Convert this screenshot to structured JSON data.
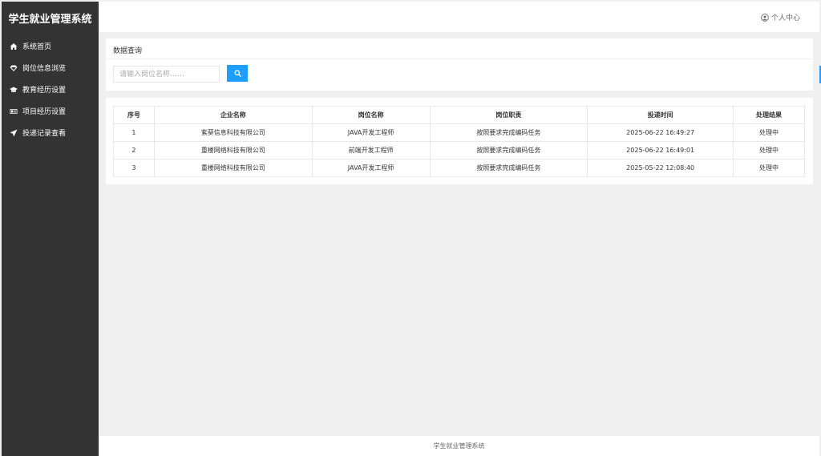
{
  "app": {
    "title": "学生就业管理系统"
  },
  "sidebar": {
    "items": [
      {
        "label": "系统首页",
        "icon": "home-icon"
      },
      {
        "label": "岗位信息浏览",
        "icon": "diamond-icon"
      },
      {
        "label": "教育经历设置",
        "icon": "graduation-cap-icon"
      },
      {
        "label": "项目经历设置",
        "icon": "id-card-icon"
      },
      {
        "label": "投递记录查看",
        "icon": "send-icon"
      }
    ]
  },
  "header": {
    "user_center": "个人中心"
  },
  "search": {
    "title": "数据查询",
    "placeholder": "请输入岗位名称……"
  },
  "table": {
    "columns": [
      "序号",
      "企业名称",
      "岗位名称",
      "岗位职责",
      "投递时间",
      "处理结果"
    ],
    "rows": [
      [
        "1",
        "紫葵信息科技有限公司",
        "JAVA开发工程师",
        "按照要求完成编码任务",
        "2025-06-22 16:49:27",
        "处理中"
      ],
      [
        "2",
        "重楼网络科技有限公司",
        "前端开发工程师",
        "按照要求完成编码任务",
        "2025-06-22 16:49:01",
        "处理中"
      ],
      [
        "3",
        "重楼网络科技有限公司",
        "JAVA开发工程师",
        "按照要求完成编码任务",
        "2025-05-22 12:08:40",
        "处理中"
      ]
    ]
  },
  "footer": {
    "text": "学生就业管理系统"
  },
  "colors": {
    "sidebar_bg": "#333333",
    "accent": "#1e9fff"
  }
}
